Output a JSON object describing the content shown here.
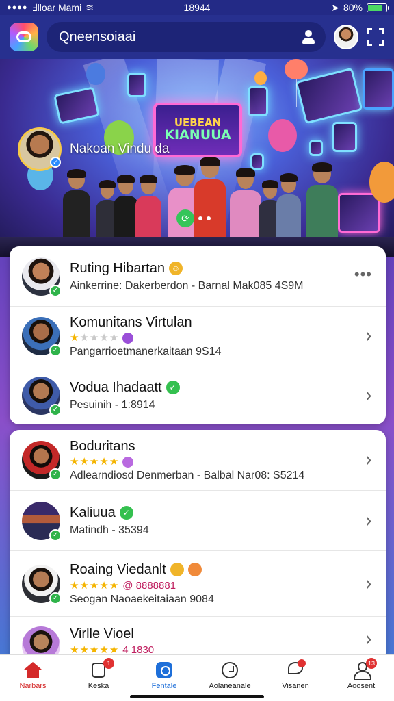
{
  "status_bar": {
    "carrier": "Ⅎlloar Mami",
    "time": "18944",
    "battery": "80%",
    "battery_level": 0.8
  },
  "header": {
    "search_text": "Qneensoiaai"
  },
  "hero": {
    "user_name": "Nakoan Vindu da",
    "sign_line1": "UEBEAN",
    "sign_line2": "KIANUUA"
  },
  "card1": {
    "items": [
      {
        "title": "Ruting Hibartan",
        "subtitle": "Ainkerrine: Dakerberdon - Barnal Mak085 4S9M",
        "emoji_color": "#f0b429",
        "emoji": "😊"
      },
      {
        "title": "Komunitans Virtulan",
        "subtitle": "Pangarrioetmanerkaitaan  9S14",
        "stars": 1,
        "emoji_color": "#9a4fd8"
      },
      {
        "title": "Vodua Ihadaatt",
        "subtitle": "Pesuinih - 1:8914",
        "emoji_color": "#34c04f",
        "emoji": "✓"
      }
    ]
  },
  "card2": {
    "items": [
      {
        "title": "Boduritans",
        "subtitle": "Adlearndiosd Denmerban - Balbal Nar08: S5214",
        "stars": 5,
        "emoji_color": "#b96ae0"
      },
      {
        "title": "Kaliuua",
        "subtitle": "Matindh - 35394",
        "emoji_color": "#34c04f",
        "emoji": "✓"
      },
      {
        "title": "Roaing Viedanlt",
        "subtitle": "Seogan Naoaekeitaiaan  9084",
        "stars": 5,
        "rating_text": "@ 8888881",
        "emoji_color": "#f0b429"
      },
      {
        "title": "Virlle Vioel",
        "stars": 5,
        "rating_text": "4 1830"
      }
    ]
  },
  "nav": {
    "items": [
      {
        "label": "Narbars",
        "badge": ""
      },
      {
        "label": "Keska",
        "badge": "1"
      },
      {
        "label": "Fentale",
        "badge": ""
      },
      {
        "label": "Aolaneanale",
        "badge": ""
      },
      {
        "label": "Visanen",
        "badge": ""
      },
      {
        "label": "Aoosent",
        "badge": "13"
      }
    ]
  }
}
